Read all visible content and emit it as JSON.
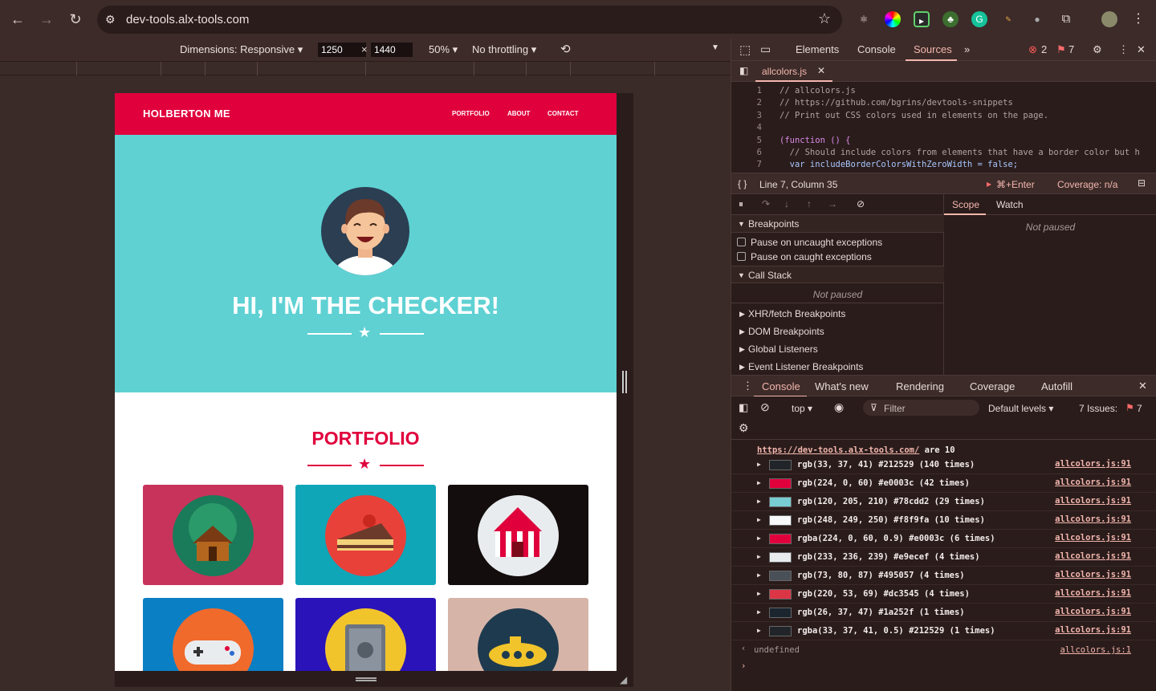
{
  "browser": {
    "url": "dev-tools.alx-tools.com"
  },
  "device_toolbar": {
    "dimensions_label": "Dimensions: Responsive",
    "width": "1250",
    "times": "×",
    "height": "1440",
    "zoom": "50%",
    "throttling": "No throttling"
  },
  "site": {
    "brand": "HOLBERTON ME",
    "nav": [
      "PORTFOLIO",
      "ABOUT",
      "CONTACT"
    ],
    "hero_title": "HI, I'M THE CHECKER!",
    "portfolio_title": "PORTFOLIO",
    "colors": {
      "red": "#e0003c",
      "teal": "#5fd1d3"
    }
  },
  "devtools": {
    "tabs": [
      "Elements",
      "Console",
      "Sources"
    ],
    "active_tab": "Sources",
    "errors": "2",
    "issues_count": "7",
    "file_tab": "allcolors.js",
    "code_lines": [
      {
        "n": "1",
        "t": "// allcolors.js"
      },
      {
        "n": "2",
        "t": "// https://github.com/bgrins/devtools-snippets"
      },
      {
        "n": "3",
        "t": "// Print out CSS colors used in elements on the page."
      },
      {
        "n": "4",
        "t": ""
      },
      {
        "n": "5",
        "t": "(function () {"
      },
      {
        "n": "6",
        "t": "  // Should include colors from elements that have a border color but h"
      },
      {
        "n": "7",
        "t": "  var includeBorderColorsWithZeroWidth = false;"
      }
    ],
    "status_position": "Line 7, Column 35",
    "run_shortcut": "⌘+Enter",
    "coverage": "Coverage: n/a",
    "breakpoints_header": "Breakpoints",
    "pause_uncaught": "Pause on uncaught exceptions",
    "pause_caught": "Pause on caught exceptions",
    "call_stack": "Call Stack",
    "not_paused": "Not paused",
    "xhr_breakpoints": "XHR/fetch Breakpoints",
    "dom_breakpoints": "DOM Breakpoints",
    "global_listeners": "Global Listeners",
    "event_listener_breakpoints": "Event Listener Breakpoints",
    "scope_tab": "Scope",
    "watch_tab": "Watch",
    "drawer_tabs": [
      "Console",
      "What's new",
      "Rendering",
      "Coverage",
      "Autofill"
    ],
    "context": "top",
    "filter_placeholder": "Filter",
    "levels": "Default levels",
    "issues_label": "7 Issues:",
    "partial_link": "https://dev-tools.alx-tools.com/",
    "partial_suffix": " are 10",
    "logs": [
      {
        "text": "rgb(33, 37, 41) #212529 (140 times)",
        "color": "#212529",
        "src": "allcolors.js:91"
      },
      {
        "text": "rgb(224, 0, 60) #e0003c (42 times)",
        "color": "#e0003c",
        "src": "allcolors.js:91"
      },
      {
        "text": "rgb(120, 205, 210) #78cdd2 (29 times)",
        "color": "#78cdd2",
        "src": "allcolors.js:91"
      },
      {
        "text": "rgb(248, 249, 250) #f8f9fa (10 times)",
        "color": "#f8f9fa",
        "src": "allcolors.js:91"
      },
      {
        "text": "rgba(224, 0, 60, 0.9) #e0003c (6 times)",
        "color": "#e0003c",
        "src": "allcolors.js:91"
      },
      {
        "text": "rgb(233, 236, 239) #e9ecef (4 times)",
        "color": "#e9ecef",
        "src": "allcolors.js:91"
      },
      {
        "text": "rgb(73, 80, 87) #495057 (4 times)",
        "color": "#495057",
        "src": "allcolors.js:91"
      },
      {
        "text": "rgb(220, 53, 69) #dc3545 (4 times)",
        "color": "#dc3545",
        "src": "allcolors.js:91"
      },
      {
        "text": "rgb(26, 37, 47) #1a252f (1 times)",
        "color": "#1a252f",
        "src": "allcolors.js:91"
      },
      {
        "text": "rgba(33, 37, 41, 0.5) #212529 (1 times)",
        "color": "#212529",
        "src": "allcolors.js:91"
      }
    ],
    "undefined_text": "undefined",
    "undefined_src": "allcolors.js:1"
  }
}
